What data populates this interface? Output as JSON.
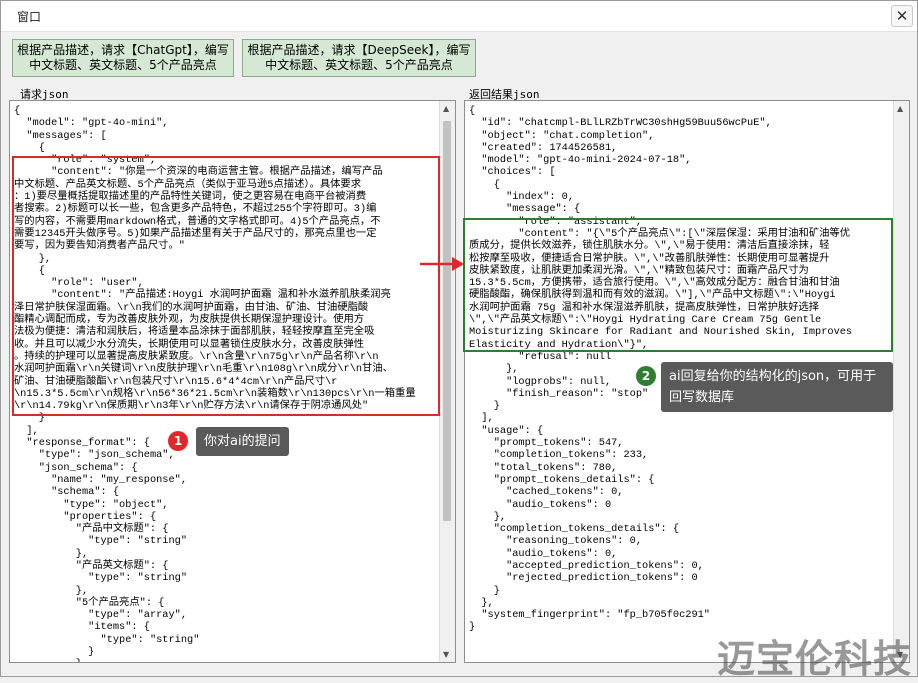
{
  "window": {
    "title": "窗口",
    "close_glyph": "✕"
  },
  "toolbar": {
    "chatgpt_button": "根据产品描述，请求【ChatGpt】，编写中文标题、英文标题、5个产品亮点",
    "deepseek_button": "根据产品描述，请求【DeepSeek】，编写中文标题、英文标题、5个产品亮点"
  },
  "request_panel": {
    "label": "请求json",
    "content": "{\n  \"model\": \"gpt-4o-mini\",\n  \"messages\": [\n    {\n      \"role\": \"system\",\n      \"content\": \"你是一个资深的电商运营主管。根据产品描述，编写产品\n中文标题、产品英文标题、5个产品亮点（类似于亚马逊5点描述）。具体要求\n：1)要尽量概括提取描述里的产品特性关键词，使之更容易在电商平台被消费\n者搜索。2)标题可以长一些，包含更多产品特色，不超过255个字符即可。3)编\n写的内容，不需要用markdown格式，普通的文字格式即可。4)5个产品亮点，不\n需要12345开头做序号。5)如果产品描述里有关于产品尺寸的，那亮点里也一定\n要写，因为要告知消费者产品尺寸。\"\n    },\n    {\n      \"role\": \"user\",\n      \"content\": \"产品描述:Hoygi 水润呵护面霜 温和补水滋养肌肤柔润亮\n泽日常护肤保湿面霜。\\r\\n我们的水润呵护面霜，由甘油、矿油、甘油硬脂酸\n酯精心调配而成，专为改善皮肤外观，为皮肤提供长期保湿护理设计。使用方\n法极为便捷：清洁和润肤后，将适量本品涂抹于面部肌肤，轻轻按摩直至完全吸\n收。并且可以减少水分流失，长期使用可以显著锁住皮肤水分，改善皮肤弹性\n。持续的护理可以显著提高皮肤紧致度。\\r\\n含量\\r\\n75g\\r\\n产品名称\\r\\n\n水润呵护面霜\\r\\n关键词\\r\\n皮肤护理\\r\\n毛重\\r\\n108g\\r\\n成分\\r\\n甘油、\n矿油、甘油硬脂酸酯\\r\\n包装尺寸\\r\\n15.6*4*4cm\\r\\n产品尺寸\\r\n\\n15.3*5.5cm\\r\\n规格\\r\\n56*36*21.5cm\\r\\n装箱数\\r\\n130pcs\\r\\n一箱重量\n\\r\\n14.79kg\\r\\n保质期\\r\\n3年\\r\\n贮存方法\\r\\n请保存于阴凉通风处\"\n    }\n  ],\n  \"response_format\": {\n    \"type\": \"json_schema\",\n    \"json_schema\": {\n      \"name\": \"my_response\",\n      \"schema\": {\n        \"type\": \"object\",\n        \"properties\": {\n          \"产品中文标题\": {\n            \"type\": \"string\"\n          },\n          \"产品英文标题\": {\n            \"type\": \"string\"\n          },\n          \"5个产品亮点\": {\n            \"type\": \"array\",\n            \"items\": {\n              \"type\": \"string\"\n            }\n          }\n        }"
  },
  "response_panel": {
    "label": "返回结果json",
    "content": "{\n  \"id\": \"chatcmpl-BLlLRZbTrWC30shHg59Buu56wcPuE\",\n  \"object\": \"chat.completion\",\n  \"created\": 1744526581,\n  \"model\": \"gpt-4o-mini-2024-07-18\",\n  \"choices\": [\n    {\n      \"index\": 0,\n      \"message\": {\n        \"role\": \"assistant\",\n        \"content\": \"{\\\"5个产品亮点\\\":[\\\"深层保湿：采用甘油和矿油等优\n质成分，提供长效滋养，锁住肌肤水分。\\\",\\\"易于使用：清洁后直接涂抹，轻\n松按摩至吸收，便捷适合日常护肤。\\\",\\\"改善肌肤弹性：长期使用可显著提升\n皮肤紧致度，让肌肤更加柔润光滑。\\\",\\\"精致包装尺寸：面霜产品尺寸为\n15.3*5.5cm，方便携带，适合旅行使用。\\\",\\\"高效成分配方：融合甘油和甘油\n硬脂酸酯，确保肌肤得到温和而有效的滋润。\\\"],\\\"产品中文标题\\\":\\\"Hoygi\n水润呵护面霜 75g 温和补水保湿滋养肌肤，提高皮肤弹性，日常护肤好选择\n\\\",\\\"产品英文标题\\\":\\\"Hoygi Hydrating Care Cream 75g Gentle\nMoisturizing Skincare for Radiant and Nourished Skin, Improves\nElasticity and Hydration\\\"}\",\n        \"refusal\": null\n      },\n      \"logprobs\": null,\n      \"finish_reason\": \"stop\"\n    }\n  ],\n  \"usage\": {\n    \"prompt_tokens\": 547,\n    \"completion_tokens\": 233,\n    \"total_tokens\": 780,\n    \"prompt_tokens_details\": {\n      \"cached_tokens\": 0,\n      \"audio_tokens\": 0\n    },\n    \"completion_tokens_details\": {\n      \"reasoning_tokens\": 0,\n      \"audio_tokens\": 0,\n      \"accepted_prediction_tokens\": 0,\n      \"rejected_prediction_tokens\": 0\n    }\n  },\n  \"system_fingerprint\": \"fp_b705f0c291\"\n}"
  },
  "annotations": {
    "badge1": "1",
    "callout1": "你对ai的提问",
    "badge2": "2",
    "callout2": "ai回复给你的结构化的json，可用于回写数据库"
  },
  "watermark": "迈宝伦科技",
  "colors": {
    "button_bg": "#d5e8d4",
    "request_highlight": "#e0282c",
    "response_highlight": "#2e7d32"
  }
}
